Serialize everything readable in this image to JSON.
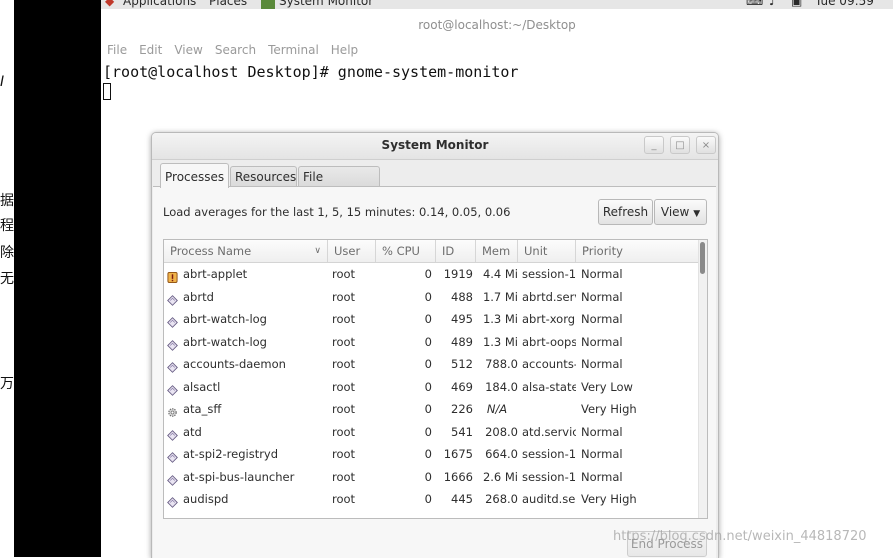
{
  "left_fragments": [
    "据",
    "程",
    "除",
    "无",
    "万"
  ],
  "left_italic": "I",
  "top_panel": {
    "applications": "Applications",
    "places": "Places",
    "running_app": "System Monitor",
    "time": "Tue 09:59"
  },
  "terminal": {
    "title": "root@localhost:~/Desktop",
    "menu": [
      "File",
      "Edit",
      "View",
      "Search",
      "Terminal",
      "Help"
    ],
    "prompt_line": "[root@localhost Desktop]# gnome-system-monitor"
  },
  "window": {
    "title": "System Monitor",
    "buttons": {
      "minimize": "_",
      "maximize": "□",
      "close": "×"
    },
    "tabs": [
      "Processes",
      "Resources",
      "File Systems"
    ],
    "active_tab": "Processes",
    "load_averages": "Load averages for the last 1, 5, 15 minutes: 0.14, 0.05, 0.06",
    "refresh_label": "Refresh",
    "view_label": "View",
    "end_process_label": "End Process"
  },
  "table": {
    "columns": [
      "Process Name",
      "User",
      "% CPU",
      "ID",
      "Mem",
      "Unit",
      "Priority"
    ],
    "rows": [
      {
        "name": "abrt-applet",
        "icon": "applet-icon",
        "user": "root",
        "cpu": "0",
        "id": "1919",
        "mem": "4.4 Mi",
        "unit": "session-1",
        "priority": "Normal"
      },
      {
        "name": "abrtd",
        "icon": "process-icon",
        "user": "root",
        "cpu": "0",
        "id": "488",
        "mem": "1.7 Mi",
        "unit": "abrtd.serv",
        "priority": "Normal"
      },
      {
        "name": "abrt-watch-log",
        "icon": "process-icon",
        "user": "root",
        "cpu": "0",
        "id": "495",
        "mem": "1.3 Mi",
        "unit": "abrt-xorg",
        "priority": "Normal"
      },
      {
        "name": "abrt-watch-log",
        "icon": "process-icon",
        "user": "root",
        "cpu": "0",
        "id": "489",
        "mem": "1.3 Mi",
        "unit": "abrt-oops",
        "priority": "Normal"
      },
      {
        "name": "accounts-daemon",
        "icon": "process-icon",
        "user": "root",
        "cpu": "0",
        "id": "512",
        "mem": "788.0",
        "unit": "accounts-",
        "priority": "Normal"
      },
      {
        "name": "alsactl",
        "icon": "process-icon",
        "user": "root",
        "cpu": "0",
        "id": "469",
        "mem": "184.0",
        "unit": "alsa-state",
        "priority": "Very Low"
      },
      {
        "name": "ata_sff",
        "icon": "gear-icon",
        "user": "root",
        "cpu": "0",
        "id": "226",
        "mem": "N/A",
        "unit": "",
        "priority": "Very High"
      },
      {
        "name": "atd",
        "icon": "process-icon",
        "user": "root",
        "cpu": "0",
        "id": "541",
        "mem": "208.0",
        "unit": "atd.servic",
        "priority": "Normal"
      },
      {
        "name": "at-spi2-registryd",
        "icon": "process-icon",
        "user": "root",
        "cpu": "0",
        "id": "1675",
        "mem": "664.0",
        "unit": "session-1",
        "priority": "Normal"
      },
      {
        "name": "at-spi-bus-launcher",
        "icon": "process-icon",
        "user": "root",
        "cpu": "0",
        "id": "1666",
        "mem": "2.6 Mi",
        "unit": "session-1",
        "priority": "Normal"
      },
      {
        "name": "audispd",
        "icon": "process-icon",
        "user": "root",
        "cpu": "0",
        "id": "445",
        "mem": "268.0",
        "unit": "auditd.ser",
        "priority": "Very High"
      }
    ]
  },
  "watermark": "https://blog.csdn.net/weixin_44818720"
}
